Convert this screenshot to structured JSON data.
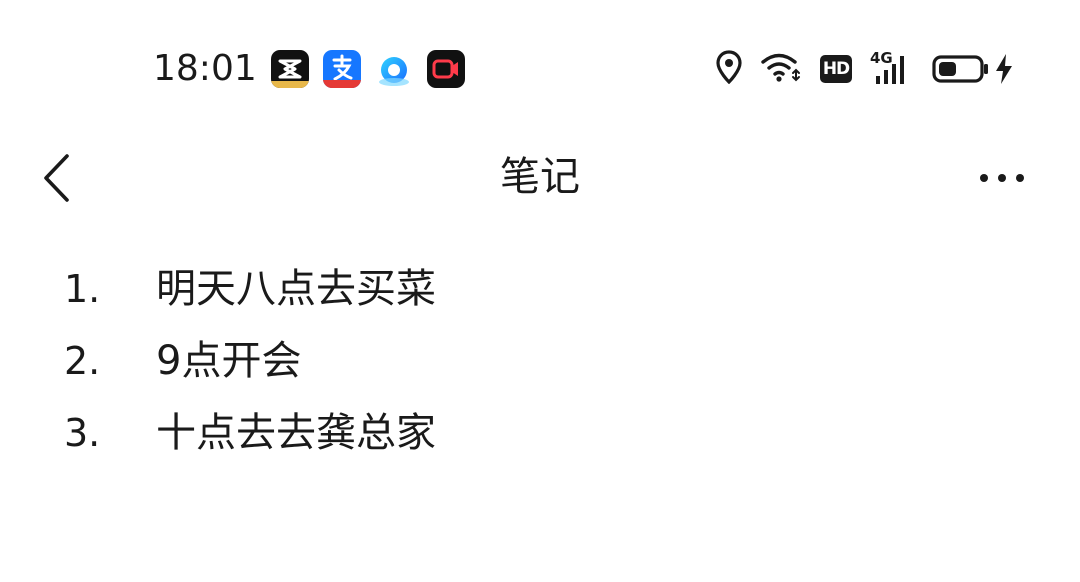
{
  "status_bar": {
    "time": "18:01",
    "notification_apps": [
      {
        "name": "capcut-app-icon"
      },
      {
        "name": "alipay-app-icon"
      },
      {
        "name": "browser-app-icon"
      },
      {
        "name": "screen-recorder-app-icon"
      }
    ],
    "hd_label": "HD",
    "network_label": "4G",
    "battery_level": 0.45,
    "charging": true
  },
  "header": {
    "title": "笔记"
  },
  "note": {
    "items": [
      {
        "number": "1.",
        "text": "明天八点去买菜"
      },
      {
        "number": "2.",
        "text": "9点开会"
      },
      {
        "number": "3.",
        "text": "十点去去龚总家"
      }
    ]
  },
  "colors": {
    "text": "#1a1a1a",
    "background": "#ffffff",
    "alipay_blue": "#1677ff"
  }
}
